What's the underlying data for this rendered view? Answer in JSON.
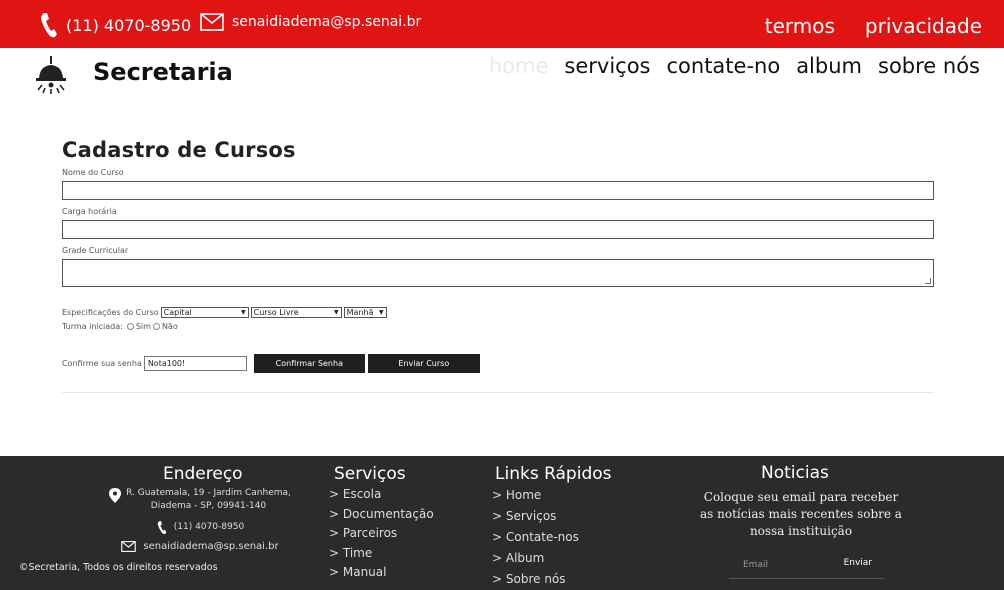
{
  "topbar": {
    "phone": "(11) 4070-8950",
    "email": "senaidiadema@sp.senai.br",
    "links": [
      "termos",
      "privacidade"
    ]
  },
  "header": {
    "brand": "Secretaria",
    "nav": [
      "home",
      "serviços",
      "contate-no",
      "album",
      "sobre nós"
    ],
    "active": "home"
  },
  "form": {
    "title": "Cadastro de Cursos",
    "course_name_label": "Nome do Curso",
    "course_name_value": "",
    "workload_label": "Carga horária",
    "workload_value": "",
    "curriculum_label": "Grade Curricular",
    "curriculum_value": "",
    "specs_label": "Especificações do Curso",
    "spec_city": "Capital",
    "spec_type": "Curso Livre",
    "spec_period": "Manhã",
    "started_label": "Turma iniciada:",
    "started_yes": "Sim",
    "started_no": "Não",
    "password_label": "Confirme sua senha",
    "password_value": "Nota100!",
    "confirm_button": "Confirmar Senha",
    "send_button": "Enviar Curso"
  },
  "footer": {
    "address_title": "Endereço",
    "address_line1": "R. Guatemala, 19 - Jardim Canhema,",
    "address_line2": "Diadema - SP, 09941-140",
    "phone": "(11) 4070-8950",
    "email": "senaidiadema@sp.senai.br",
    "services_title": "Serviços",
    "services": [
      "> Escola",
      "> Documentação",
      "> Parceiros",
      "> Time",
      "> Manual"
    ],
    "links_title": "Links Rápidos",
    "links": [
      "> Home",
      "> Serviços",
      "> Contate-nos",
      "> Album",
      "> Sobre nós"
    ],
    "news_title": "Noticias",
    "news_text": "Coloque seu email para receber as notícias mais recentes sobre a nossa instituição",
    "email_placeholder": "Email",
    "send_label": "Enviar",
    "copyright": "©Secretaria, Todos os direitos reservados"
  },
  "colors": {
    "accent": "#e11414",
    "footer_bg": "#2b2b2b",
    "button_bg": "#1f1f1f"
  }
}
